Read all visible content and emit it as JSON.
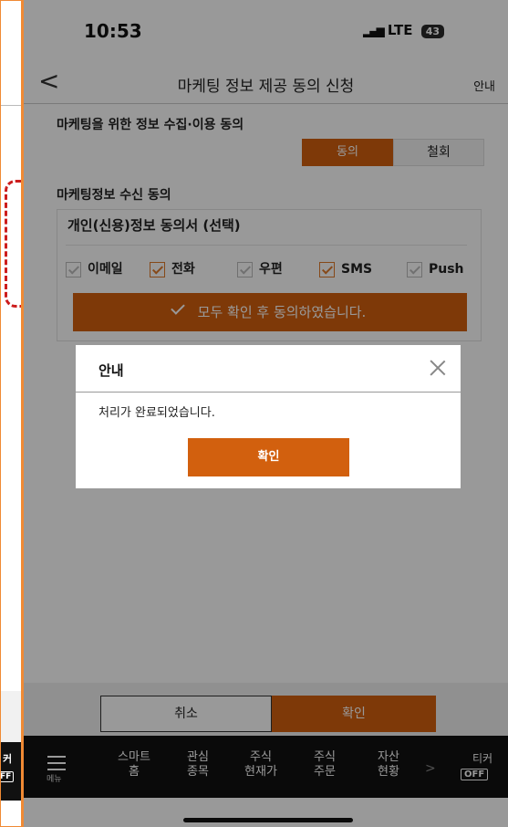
{
  "left_panel": {
    "ticker_label": "커",
    "ticker_off": "FF"
  },
  "status_bar": {
    "time": "10:53",
    "network": "LTE",
    "battery": "43"
  },
  "header": {
    "title": "마케팅 정보 제공 동의 신청",
    "help": "안내"
  },
  "collection_consent": {
    "label": "마케팅을 위한 정보 수집·이용 동의",
    "agree": "동의",
    "withdraw": "철회"
  },
  "receive_consent": {
    "label": "마케팅정보 수신 동의",
    "box_title": "개인(신용)정보 동의서 (선택)",
    "options": [
      {
        "label": "이메일",
        "checked": false
      },
      {
        "label": "전화",
        "checked": true
      },
      {
        "label": "우편",
        "checked": false
      },
      {
        "label": "SMS",
        "checked": true
      },
      {
        "label": "Push",
        "checked": false
      }
    ],
    "agree_all": "모두 확인 후 동의하였습니다."
  },
  "modal": {
    "title": "안내",
    "message": "처리가 완료되었습니다.",
    "confirm": "확인"
  },
  "actions": {
    "cancel": "취소",
    "confirm": "확인"
  },
  "bottom_nav": {
    "menu": "메뉴",
    "items": [
      {
        "line1": "스마트",
        "line2": "홈"
      },
      {
        "line1": "관심",
        "line2": "종목"
      },
      {
        "line1": "주식",
        "line2": "현재가"
      },
      {
        "line1": "주식",
        "line2": "주문"
      },
      {
        "line1": "자산",
        "line2": "현황"
      }
    ],
    "ticker": "티커",
    "ticker_state": "OFF"
  },
  "colors": {
    "accent": "#d2600e",
    "panel_border": "#f08a34",
    "highlight_dash": "#cc1d1d"
  }
}
